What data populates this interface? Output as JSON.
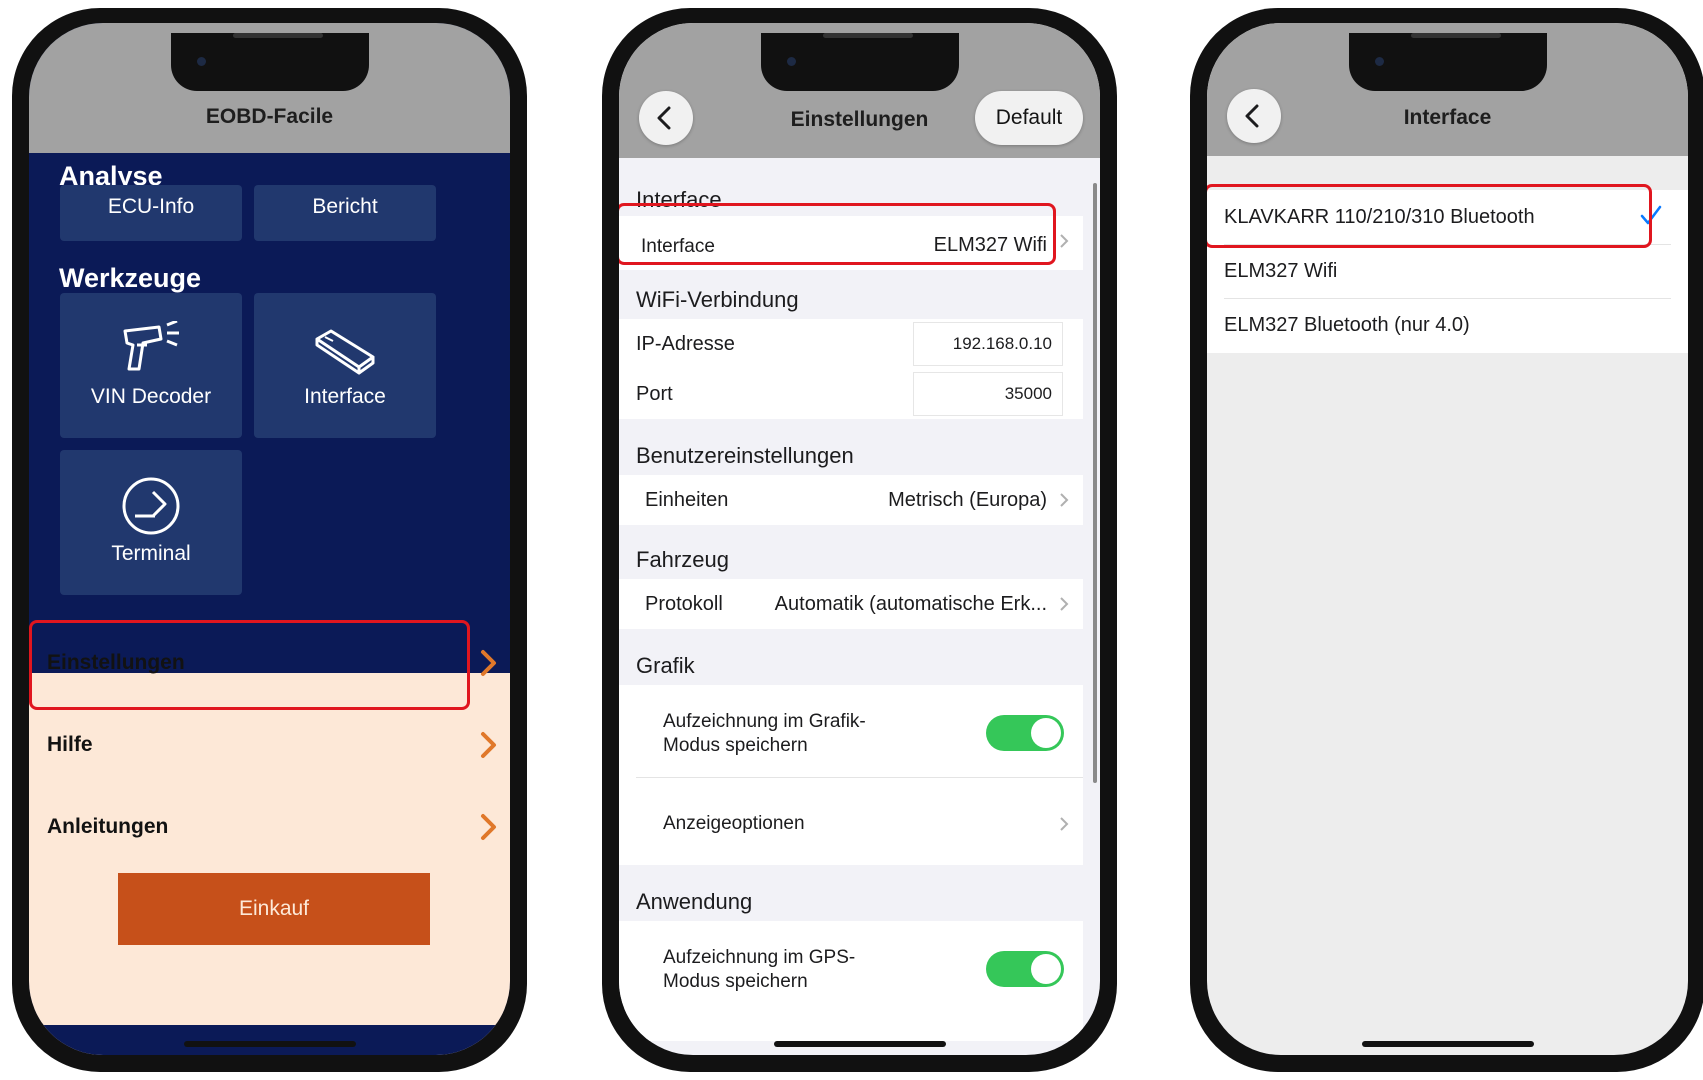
{
  "phone1": {
    "title": "EOBD-Facile",
    "analyse": {
      "title": "Analyse",
      "tiles": [
        "ECU-Info",
        "Bericht"
      ]
    },
    "werkzeuge": {
      "title": "Werkzeuge",
      "tiles": [
        {
          "label": "VIN Decoder",
          "icon": "barcode-scanner-icon"
        },
        {
          "label": "Interface",
          "icon": "obd-dongle-icon"
        },
        {
          "label": "Terminal",
          "icon": "terminal-arrow-icon"
        }
      ]
    },
    "menu": [
      "Einstellungen",
      "Hilfe",
      "Anleitungen"
    ],
    "buy_button": "Einkauf",
    "colors": {
      "background": "#0b1a57",
      "tile": "#21386e",
      "menu": "#fde8d7",
      "buy": "#c6501a",
      "highlight": "#e0161f"
    }
  },
  "phone2": {
    "title": "Einstellungen",
    "default_button": "Default",
    "groups": {
      "interface": {
        "title": "Interface",
        "row": {
          "label": "Interface",
          "value": "ELM327 Wifi"
        }
      },
      "wifi": {
        "title": "WiFi-Verbindung",
        "ip": {
          "label": "IP-Adresse",
          "value": "192.168.0.10"
        },
        "port": {
          "label": "Port",
          "value": "35000"
        }
      },
      "user": {
        "title": "Benutzereinstellungen",
        "row": {
          "label": "Einheiten",
          "value": "Metrisch (Europa)"
        }
      },
      "vehicle": {
        "title": "Fahrzeug",
        "row": {
          "label": "Protokoll",
          "value": "Automatik (automatische Erk..."
        }
      },
      "graphics": {
        "title": "Grafik",
        "record": {
          "line1": "Aufzeichnung im Grafik-",
          "line2": "Modus speichern",
          "on": true
        },
        "display": "Anzeigeoptionen"
      },
      "app": {
        "title": "Anwendung",
        "record": {
          "line1": "Aufzeichnung im GPS-",
          "line2": "Modus speichern",
          "on": true
        }
      }
    },
    "colors": {
      "toggle_on": "#35c759"
    }
  },
  "phone3": {
    "title": "Interface",
    "options": [
      {
        "label": "KLAVKARR 110/210/310 Bluetooth",
        "selected": true
      },
      {
        "label": "ELM327 Wifi",
        "selected": false
      },
      {
        "label": "ELM327 Bluetooth (nur 4.0)",
        "selected": false
      }
    ],
    "colors": {
      "check": "#0a7aff"
    }
  }
}
